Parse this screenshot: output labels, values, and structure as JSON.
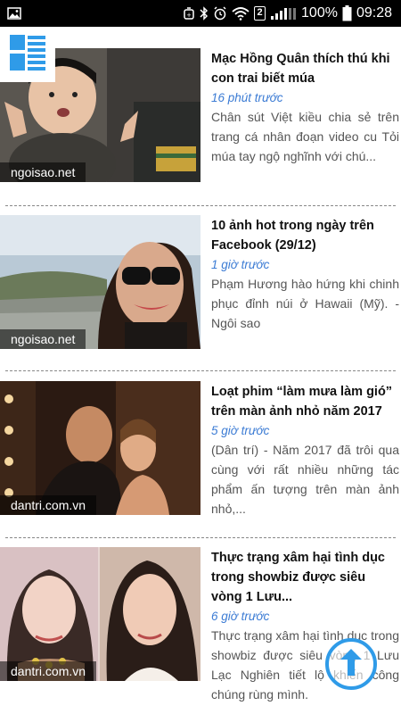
{
  "status_bar": {
    "battery": "100%",
    "time": "09:28",
    "sim": "2",
    "icons": [
      "gallery-icon",
      "alarm-icon",
      "bluetooth-icon",
      "wifi-icon",
      "signal-icon",
      "battery-icon"
    ]
  },
  "menu": {
    "icon": "menu-grid-icon"
  },
  "articles": [
    {
      "title": "Mạc Hồng Quân thích thú khi con trai biết múa",
      "time": "16 phút trước",
      "summary": "Chân sút Việt kiều chia sẻ trên trang cá nhân đoạn video cu Tỏi múa tay ngộ nghĩnh với chú...",
      "source": "ngoisao.net"
    },
    {
      "title": "10 ảnh hot trong ngày trên Facebook (29/12)",
      "time": "1 giờ trước",
      "summary": "Phạm Hương hào hứng khi chinh phục đỉnh núi ở Hawaii (Mỹ). - Ngôi sao",
      "source": "ngoisao.net"
    },
    {
      "title": "Loạt phim “làm mưa làm gió” trên màn ảnh nhỏ năm 2017",
      "time": "5 giờ trước",
      "summary": "(Dân trí) - Năm 2017 đã trôi qua cùng với rất nhiều những tác phẩm ấn tượng trên màn ảnh nhỏ,...",
      "source": "dantri.com.vn"
    },
    {
      "title": "Thực trạng xâm hại tình dục trong showbiz được siêu vòng 1 Lưu...",
      "time": "6 giờ trước",
      "summary": "Thực trạng xâm hại tình dục trong showbiz được siêu vòng 1 Lưu Lạc Nghiên tiết lộ khiến công chúng rùng mình.",
      "source": "dantri.com.vn"
    }
  ],
  "colors": {
    "time_text": "#3b7bd4",
    "accent": "#2f9be8"
  }
}
